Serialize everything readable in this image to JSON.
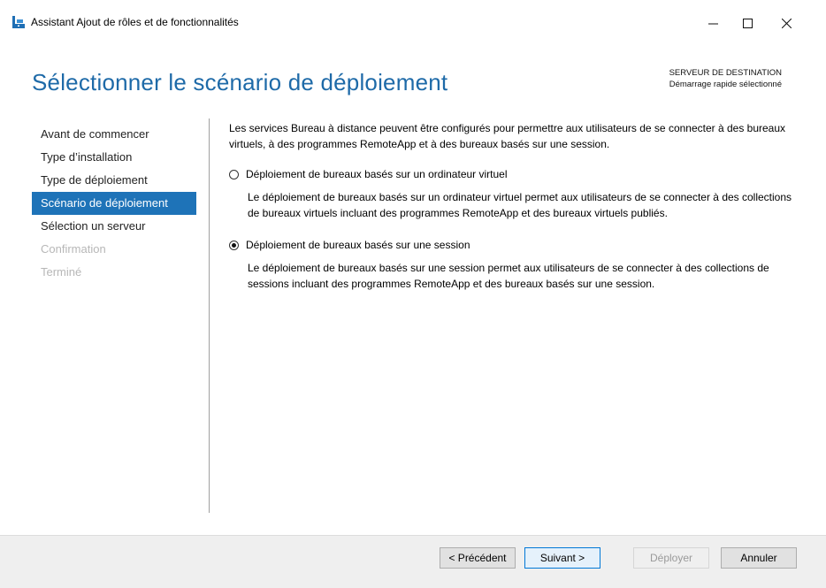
{
  "window": {
    "title": "Assistant Ajout de rôles et de fonctionnalités",
    "icon": "server-manager-icon"
  },
  "header": {
    "page_title": "Sélectionner le scénario de déploiement",
    "dest_line1": "SERVEUR DE DESTINATION",
    "dest_line2": "Démarrage rapide sélectionné"
  },
  "nav": {
    "items": [
      {
        "label": "Avant de commencer",
        "state": "normal"
      },
      {
        "label": "Type d’installation",
        "state": "normal"
      },
      {
        "label": "Type de déploiement",
        "state": "normal"
      },
      {
        "label": "Scénario de déploiement",
        "state": "active"
      },
      {
        "label": "Sélection un serveur",
        "state": "normal"
      },
      {
        "label": "Confirmation",
        "state": "disabled"
      },
      {
        "label": "Terminé",
        "state": "disabled"
      }
    ]
  },
  "content": {
    "intro": "Les services Bureau à distance peuvent être configurés pour permettre aux utilisateurs de se connecter à des bureaux virtuels, à des programmes RemoteApp et à des bureaux basés sur une session.",
    "options": [
      {
        "label": "Déploiement de bureaux basés sur un ordinateur virtuel",
        "description": "Le déploiement de bureaux basés sur un ordinateur virtuel permet aux utilisateurs de se connecter à des collections de bureaux virtuels incluant des programmes RemoteApp et des bureaux virtuels publiés.",
        "selected": false
      },
      {
        "label": "Déploiement de bureaux basés sur une session",
        "description": "Le déploiement de bureaux basés sur une session permet aux utilisateurs de se connecter à des collections de sessions incluant des programmes RemoteApp et des bureaux basés sur une session.",
        "selected": true
      }
    ]
  },
  "buttons": {
    "previous": "< Précédent",
    "next": "Suivant >",
    "deploy": "Déployer",
    "cancel": "Annuler"
  },
  "colors": {
    "accent": "#1e73b8",
    "title": "#1e6aa8"
  }
}
